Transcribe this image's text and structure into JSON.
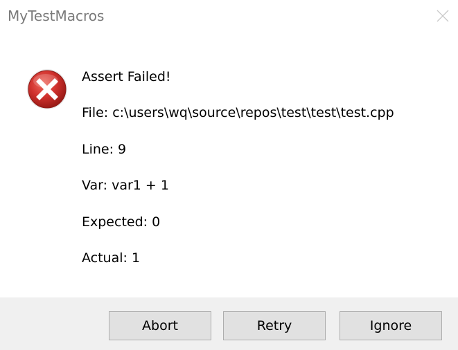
{
  "window": {
    "title": "MyTestMacros"
  },
  "icon": {
    "name": "error-icon",
    "accent": "#c42b1c"
  },
  "message": {
    "heading": "Assert Failed!",
    "file": "File: c:\\users\\wq\\source\\repos\\test\\test\\test.cpp",
    "line": "Line: 9",
    "var": "Var: var1 + 1",
    "expected": "Expected: 0",
    "actual": "Actual: 1"
  },
  "buttons": {
    "abort": "Abort",
    "retry": "Retry",
    "ignore": "Ignore"
  }
}
